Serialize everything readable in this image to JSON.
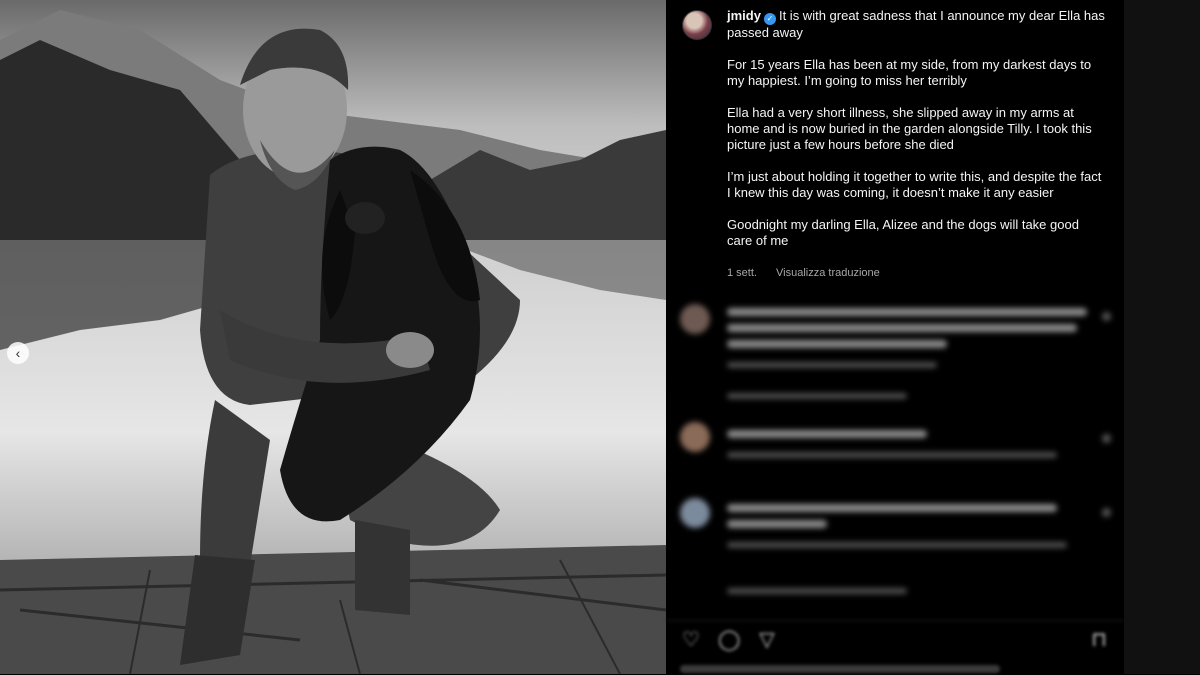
{
  "post": {
    "username": "jmidy",
    "verified_mark": "✓",
    "caption_first": "It is with great sadness that I announce my dear Ella has passed away",
    "paragraphs": [
      "For 15 years Ella has been at my side, from my darkest days to my happiest. I’m going to miss her terribly",
      "Ella had a very short illness, she slipped away in my arms at home and is now buried in the garden alongside Tilly. I took this picture just a few hours before she died",
      "I’m just about holding it together to write this, and despite the fact I knew this day was coming, it doesn’t make it any easier",
      "Goodnight my darling Ella, Alizee and the dogs will take good care of me"
    ],
    "time_ago": "1 sett.",
    "translate_label": "Visualizza traduzione"
  },
  "carousel": {
    "prev_glyph": "‹"
  },
  "actions": {
    "like_glyph": "♡",
    "comment_glyph": "◯",
    "share_glyph": "▽",
    "save_glyph": "⊓"
  },
  "colors": {
    "background": "#000000",
    "text": "#f5f5f5",
    "secondary_text": "#a8a8a8",
    "verified": "#3897f0"
  }
}
